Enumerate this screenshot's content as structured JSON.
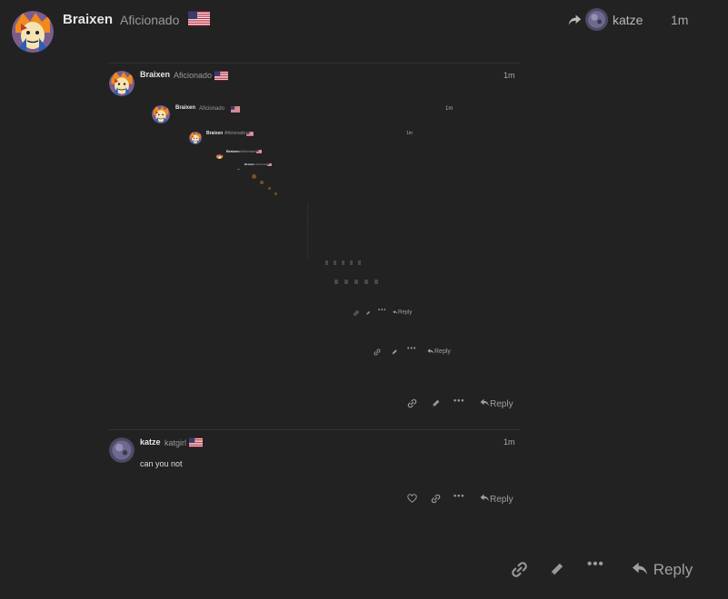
{
  "post": {
    "author": "Braixen",
    "user_title": "Aficionado",
    "reply_to_user": "katze",
    "time": "1m",
    "actions": {
      "reply_label": "Reply"
    }
  },
  "quote_outer": {
    "author": "Braixen",
    "user_title": "Aficionado",
    "time": "1m",
    "reply_label": "Reply"
  },
  "quote_level2": {
    "author": "Braixen",
    "user_title": "Aficionado",
    "time": "1m",
    "reply_label": "Reply"
  },
  "quote_level3": {
    "author": "Braixen",
    "user_title": "Aficionado",
    "time": "1m",
    "reply_label": "Reply"
  },
  "quote_level4": {
    "author": "Braixen",
    "user_title": "Aficionado",
    "reply_label": "Reply"
  },
  "quote_level5": {
    "author": "Braixen",
    "user_title": "Aficionado",
    "reply_label": "Reply"
  },
  "katze_post": {
    "author": "katze",
    "user_title": "katgirl",
    "time": "1m",
    "body": "can you not",
    "reply_label": "Reply"
  },
  "colors": {
    "background": "#222222",
    "text": "#dddddd",
    "muted": "#9a9a9a",
    "divider": "#333333"
  },
  "icons": [
    "share-arrow-icon",
    "link-icon",
    "pencil-icon",
    "more-icon",
    "reply-icon",
    "heart-icon",
    "us-flag-icon"
  ]
}
